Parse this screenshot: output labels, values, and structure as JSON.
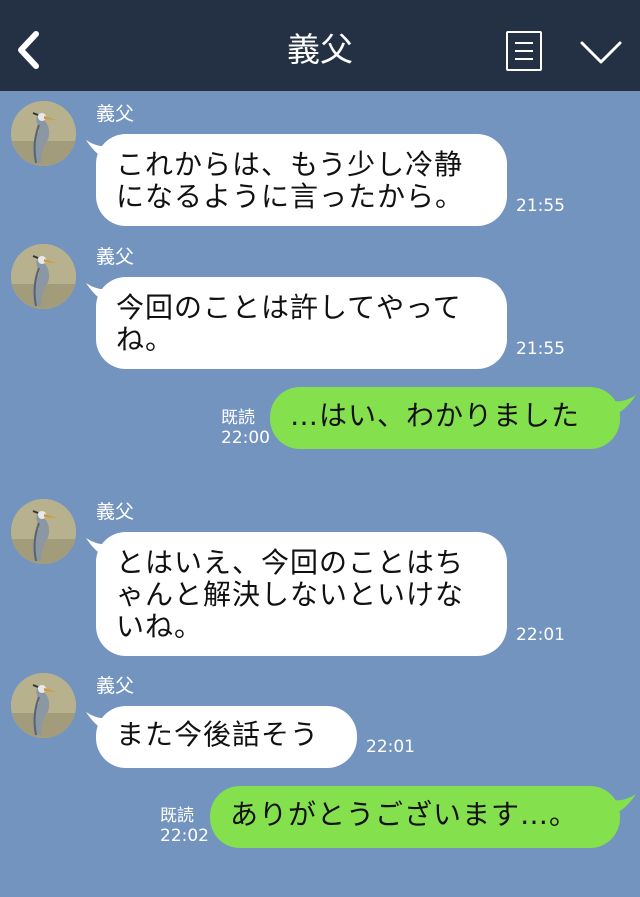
{
  "header": {
    "title": "義父"
  },
  "messages": [
    {
      "sender": "義父",
      "lines": [
        "これからは、もう少し冷静",
        "になるように言ったから。"
      ],
      "time": "21:55"
    },
    {
      "sender": "義父",
      "lines": [
        "今回のことは許してやって",
        "ね。"
      ],
      "time": "21:55"
    },
    {
      "read": "既読",
      "time": "22:00",
      "lines": [
        "…はい、わかりました"
      ]
    },
    {
      "sender": "義父",
      "lines": [
        "とはいえ、今回のことはち",
        "ゃんと解決しないといけな",
        "いね。"
      ],
      "time": "22:01"
    },
    {
      "sender": "義父",
      "lines": [
        "また今後話そう"
      ],
      "time": "22:01"
    },
    {
      "read": "既読",
      "time": "22:02",
      "lines": [
        "ありがとうございます…。"
      ]
    }
  ],
  "colors": {
    "background": "#7494c0",
    "header": "#243044",
    "incoming": "#ffffff",
    "outgoing": "#84e04c"
  },
  "icons": {
    "back": "chevron-left-icon",
    "menu": "notes-icon",
    "collapse": "chevron-down-icon",
    "avatar": "heron-avatar"
  }
}
